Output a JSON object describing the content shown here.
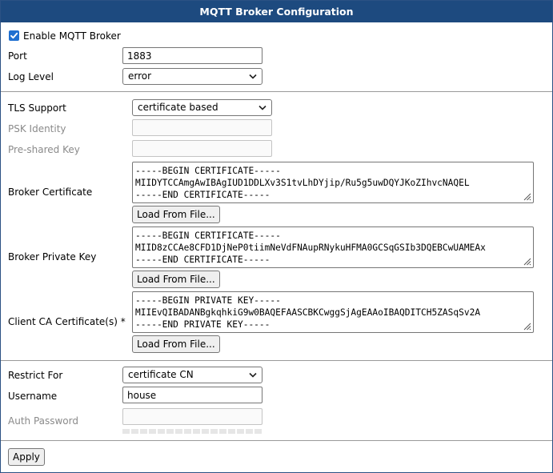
{
  "title": "MQTT Broker Configuration",
  "enable": {
    "label": "Enable MQTT Broker",
    "checked": true
  },
  "port": {
    "label": "Port",
    "value": "1883"
  },
  "log_level": {
    "label": "Log Level",
    "value": "error"
  },
  "tls": {
    "label": "TLS Support",
    "value": "certificate based"
  },
  "psk_identity": {
    "label": "PSK Identity",
    "value": ""
  },
  "psk_key": {
    "label": "Pre-shared Key",
    "value": ""
  },
  "broker_cert": {
    "label": "Broker Certificate",
    "lines": [
      "-----BEGIN CERTIFICATE-----",
      "MIIDYTCCAmgAwIBAgIUD1DDLXv3S1tvLhDYjip/Ru5g5uwDQYJKoZIhvcNAQEL",
      "-----END CERTIFICATE-----"
    ],
    "button": "Load From File..."
  },
  "broker_key": {
    "label": "Broker Private Key",
    "lines": [
      "-----BEGIN CERTIFICATE-----",
      "MIID8zCCAe8CFD1DjNeP0tiimNeVdFNAupRNykuHFMA0GCSqGSIb3DQEBCwUAMEAx",
      "-----END CERTIFICATE-----"
    ],
    "button": "Load From File..."
  },
  "client_ca": {
    "label": "Client CA Certificate(s) *",
    "lines": [
      "-----BEGIN PRIVATE KEY-----",
      "MIIEvQIBADANBgkqhkiG9w0BAQEFAASCBKCwggSjAgEAAoIBAQDITCH5ZASqSv2A",
      "-----END PRIVATE KEY-----"
    ],
    "button": "Load From File..."
  },
  "restrict": {
    "label": "Restrict For",
    "value": "certificate CN"
  },
  "username": {
    "label": "Username",
    "value": "house"
  },
  "auth_password": {
    "label": "Auth Password",
    "value": ""
  },
  "apply_label": "Apply",
  "colors": {
    "header": "#1d4a7f",
    "checkbox": "#1f6fd0",
    "disabled_text": "#8a8a8a"
  }
}
